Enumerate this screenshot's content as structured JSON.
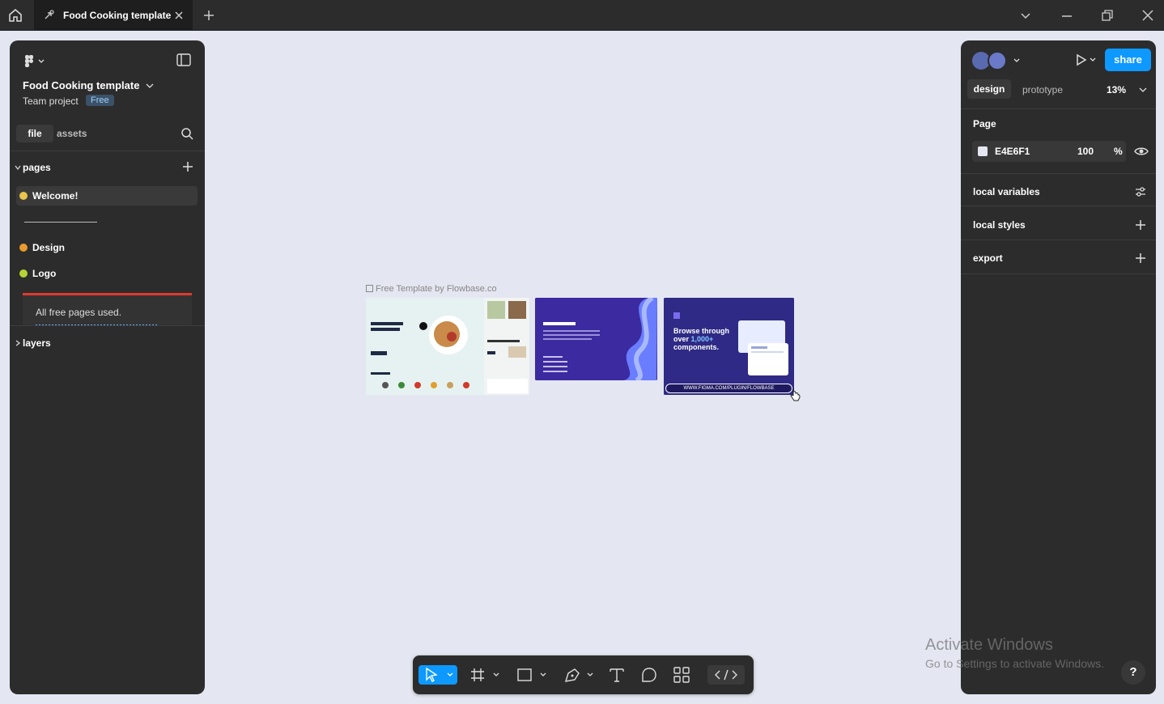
{
  "titlebar": {
    "tab_label": "Food Cooking template",
    "icons": [
      "home-icon",
      "figma-file-icon",
      "close-icon",
      "plus-icon",
      "chevron-down-icon",
      "minimize-icon",
      "restore-icon",
      "close-window-icon"
    ]
  },
  "left_panel": {
    "project_title": "Food Cooking template",
    "project_sub": "Team project",
    "plan_badge": "Free",
    "tabs": {
      "file": "file",
      "assets": "assets"
    },
    "pages_label": "pages",
    "pages": [
      {
        "label": "Welcome!",
        "selected": true,
        "emoji_color": "#e8c44a"
      },
      {
        "label": "Design",
        "selected": false,
        "emoji_color": "#e89a2c"
      },
      {
        "label": "Logo",
        "selected": false,
        "emoji_color": "#b5d334"
      }
    ],
    "free_notice": "All free pages used.",
    "layers_label": "layers"
  },
  "canvas": {
    "background": "#E4E6F1",
    "frame_label": "Free Template by Flowbase.co",
    "thumb3_headline_a": "Browse through over ",
    "thumb3_headline_b": "1,000+",
    "thumb3_headline_c": " components.",
    "thumb3_url": "WWW.FIGMA.COM/PLUGIN/FLOWBASE"
  },
  "right_panel": {
    "share": "share",
    "tab_design": "design",
    "tab_prototype": "prototype",
    "zoom": "13%",
    "page_label": "Page",
    "page_color_hex": "E4E6F1",
    "page_color_opacity": "100",
    "page_color_pct": "%",
    "local_variables": "local variables",
    "local_styles": "local styles",
    "export": "export"
  },
  "toolbar": {
    "tools": [
      "move-tool-icon",
      "frame-tool-icon",
      "rectangle-tool-icon",
      "pen-tool-icon",
      "text-tool-icon",
      "comment-tool-icon",
      "components-tool-icon",
      "dev-mode-icon"
    ]
  },
  "watermark": {
    "line1": "Activate Windows",
    "line2": "Go to Settings to activate Windows."
  },
  "help": "?",
  "colors": {
    "accent": "#0d99ff",
    "panel": "#2c2c2c",
    "warning": "#e0392f"
  }
}
